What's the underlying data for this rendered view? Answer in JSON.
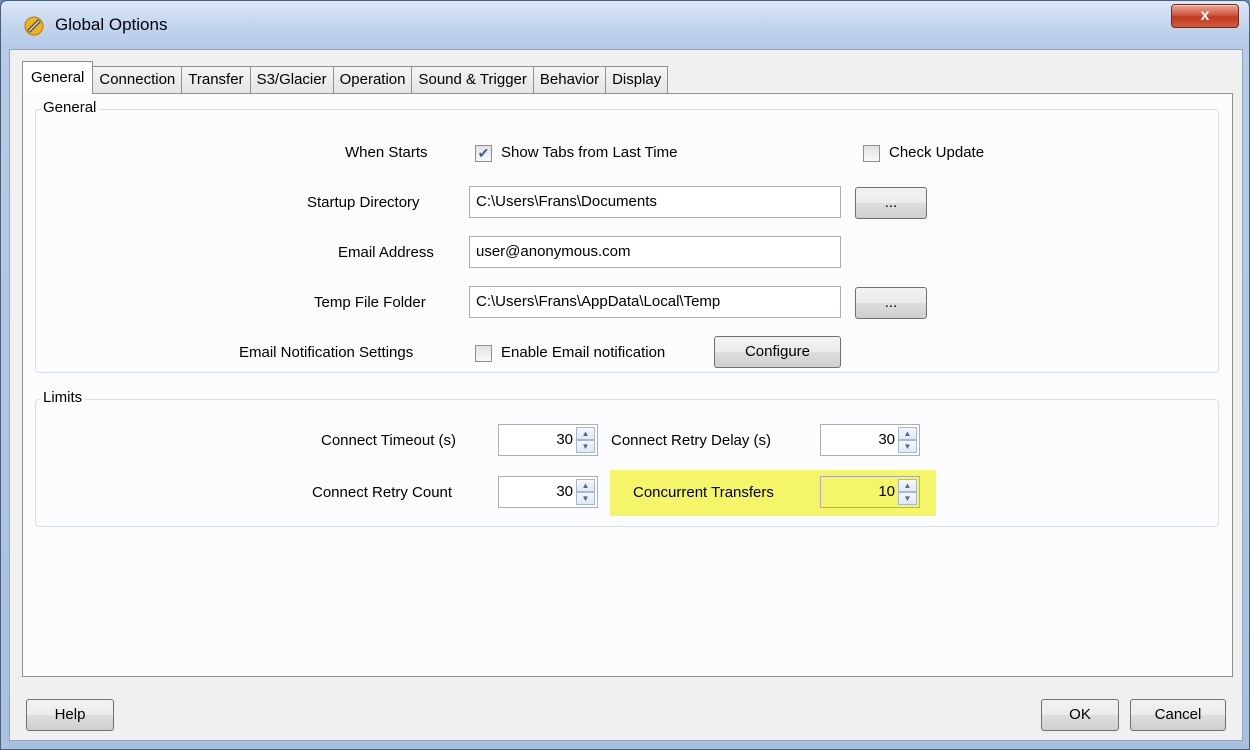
{
  "window": {
    "title": "Global Options",
    "close_label": "x"
  },
  "tabs": [
    "General",
    "Connection",
    "Transfer",
    "S3/Glacier",
    "Operation",
    "Sound & Trigger",
    "Behavior",
    "Display"
  ],
  "active_tab": "General",
  "general": {
    "group_label": "General",
    "when_starts_label": "When Starts",
    "show_tabs_label": "Show Tabs from Last Time",
    "show_tabs_checked": true,
    "check_update_label": "Check Update",
    "check_update_checked": false,
    "startup_dir_label": "Startup Directory",
    "startup_dir_value": "C:\\Users\\Frans\\Documents",
    "browse_label": "...",
    "email_label": "Email Address",
    "email_value": "user@anonymous.com",
    "temp_folder_label": "Temp File Folder",
    "temp_folder_value": "C:\\Users\\Frans\\AppData\\Local\\Temp",
    "email_notif_label": "Email Notification Settings",
    "enable_email_label": "Enable Email notification",
    "enable_email_checked": false,
    "configure_label": "Configure"
  },
  "limits": {
    "group_label": "Limits",
    "connect_timeout_label": "Connect Timeout (s)",
    "connect_timeout_value": "30",
    "retry_delay_label": "Connect Retry Delay (s)",
    "retry_delay_value": "30",
    "retry_count_label": "Connect Retry Count",
    "retry_count_value": "30",
    "concurrent_label": "Concurrent Transfers",
    "concurrent_value": "10",
    "highlight_color": "#f5f56a"
  },
  "footer": {
    "help_label": "Help",
    "ok_label": "OK",
    "cancel_label": "Cancel"
  }
}
